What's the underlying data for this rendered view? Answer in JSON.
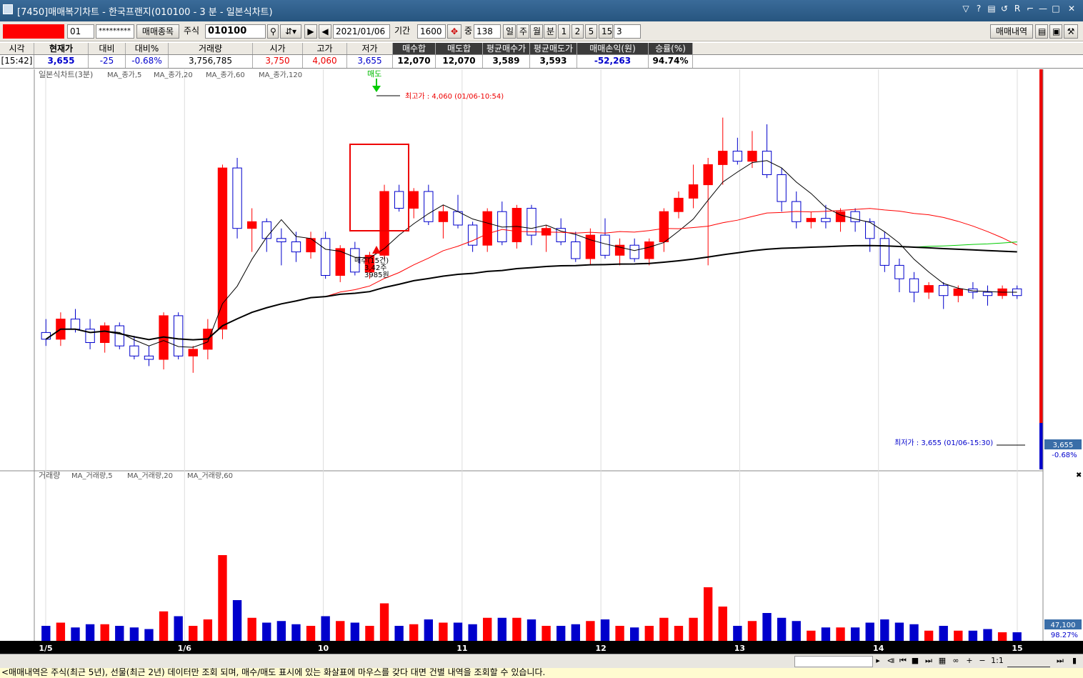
{
  "window": {
    "title": "[7450]매매복기차트 - 한국프랜지(010100 - 3 분 - 일본식차트)",
    "buttons": [
      "▽",
      "?",
      "▤",
      "↺",
      "R",
      "⌐",
      "—",
      "□",
      "✕"
    ]
  },
  "toolbar": {
    "account_no": "01",
    "password": "*********",
    "trade_item_btn": "매매종목",
    "market": "주식",
    "code": "010100",
    "date": "2021/01/06",
    "period_label": "기간",
    "period": "1600",
    "middle_label": "중",
    "count": "138",
    "periods": [
      "일",
      "주",
      "월",
      "분",
      "1",
      "2",
      "5",
      "15"
    ],
    "active_period": "분",
    "interval": "3",
    "trade_history_btn": "매매내역"
  },
  "info": {
    "headers": [
      "시각",
      "현재가",
      "대비",
      "대비%",
      "거래량",
      "시가",
      "고가",
      "저가",
      "매수합",
      "매도합",
      "평균매수가",
      "평균매도가",
      "매매손익(원)",
      "승률(%)"
    ],
    "values": [
      "[15:42]",
      "3,655",
      "-25",
      "-0.68%",
      "3,756,785",
      "3,750",
      "4,060",
      "3,655",
      "12,070",
      "12,070",
      "3,589",
      "3,593",
      "-52,263",
      "94.74%"
    ]
  },
  "price_panel": {
    "legend": "일본식차트(3분)",
    "ma_labels": [
      "MA_종가,5",
      "MA_종가,20",
      "MA_종가,60",
      "MA_종가,120"
    ],
    "high_note": "최고가 : 4,060 (01/06-10:54)",
    "low_note": "최저가 : 3,655 (01/06-15:30)",
    "sell_marker": "매도",
    "buy_note": [
      "매수(15건)",
      "3,42주",
      "3985원"
    ],
    "current_price": "3,655",
    "current_change": "-0.68%"
  },
  "volume_panel": {
    "legend": "거래량",
    "ma_labels": [
      "MA_거래량,5",
      "MA_거래량,20",
      "MA_거래량,60"
    ],
    "current_volume": "47,100",
    "volume_ratio": "98.27%"
  },
  "x_axis": {
    "labels": [
      "1/5",
      "1/6",
      "10",
      "11",
      "12",
      "13",
      "14",
      "15"
    ]
  },
  "bottom": {
    "zoom": "1:1"
  },
  "status": "<매매내역은 주식(최근 5년), 선물(최근 2년) 데이터만 조회 되며, 매수/매도 표시에 있는 화살표에 마우스를 갖다 대면 건별 내역을 조회할 수 있습니다.",
  "colors": {
    "up": "#ff0000",
    "down": "#0000cc",
    "ma5": "#000000",
    "ma20": "#ff0000",
    "ma60": "#00cc00",
    "ma120": "#000000"
  },
  "chart_data": {
    "type": "candlestick",
    "title": "",
    "ylabel": "",
    "ylim": [
      3600,
      4100
    ],
    "series": [
      {
        "name": "MA_종가,5"
      },
      {
        "name": "MA_종가,20"
      },
      {
        "name": "MA_종가,60"
      },
      {
        "name": "MA_종가,120"
      }
    ],
    "candles": [
      [
        3740,
        3760,
        3720,
        3730
      ],
      [
        3730,
        3770,
        3720,
        3760
      ],
      [
        3760,
        3775,
        3740,
        3745
      ],
      [
        3745,
        3760,
        3715,
        3725
      ],
      [
        3725,
        3755,
        3710,
        3750
      ],
      [
        3750,
        3755,
        3715,
        3720
      ],
      [
        3720,
        3735,
        3700,
        3705
      ],
      [
        3705,
        3720,
        3690,
        3700
      ],
      [
        3700,
        3770,
        3685,
        3765
      ],
      [
        3765,
        3770,
        3700,
        3705
      ],
      [
        3705,
        3720,
        3680,
        3715
      ],
      [
        3715,
        3760,
        3700,
        3745
      ],
      [
        3745,
        3990,
        3730,
        3985
      ],
      [
        3985,
        4000,
        3880,
        3895
      ],
      [
        3895,
        3925,
        3860,
        3905
      ],
      [
        3905,
        3910,
        3860,
        3880
      ],
      [
        3880,
        3895,
        3840,
        3875
      ],
      [
        3875,
        3890,
        3845,
        3860
      ],
      [
        3860,
        3890,
        3850,
        3880
      ],
      [
        3880,
        3890,
        3820,
        3825
      ],
      [
        3825,
        3870,
        3815,
        3865
      ],
      [
        3865,
        3875,
        3825,
        3830
      ],
      [
        3830,
        3860,
        3820,
        3855
      ],
      [
        3855,
        3960,
        3850,
        3950
      ],
      [
        3950,
        3960,
        3920,
        3925
      ],
      [
        3925,
        3955,
        3910,
        3950
      ],
      [
        3950,
        3960,
        3900,
        3905
      ],
      [
        3905,
        3930,
        3880,
        3920
      ],
      [
        3920,
        3945,
        3895,
        3900
      ],
      [
        3900,
        3905,
        3860,
        3870
      ],
      [
        3870,
        3925,
        3860,
        3920
      ],
      [
        3920,
        3935,
        3870,
        3875
      ],
      [
        3875,
        3930,
        3865,
        3925
      ],
      [
        3925,
        3930,
        3870,
        3885
      ],
      [
        3885,
        3900,
        3860,
        3895
      ],
      [
        3895,
        3910,
        3870,
        3875
      ],
      [
        3875,
        3890,
        3845,
        3850
      ],
      [
        3850,
        3895,
        3840,
        3885
      ],
      [
        3885,
        3910,
        3850,
        3855
      ],
      [
        3855,
        3880,
        3840,
        3870
      ],
      [
        3870,
        3880,
        3845,
        3850
      ],
      [
        3850,
        3880,
        3840,
        3875
      ],
      [
        3875,
        3925,
        3860,
        3920
      ],
      [
        3920,
        3950,
        3910,
        3940
      ],
      [
        3940,
        3990,
        3925,
        3960
      ],
      [
        3960,
        4000,
        3840,
        3990
      ],
      [
        3990,
        4060,
        3960,
        4010
      ],
      [
        4010,
        4030,
        3990,
        3995
      ],
      [
        3995,
        4040,
        3985,
        4010
      ],
      [
        4010,
        4050,
        3970,
        3975
      ],
      [
        3975,
        3985,
        3920,
        3935
      ],
      [
        3935,
        3950,
        3895,
        3905
      ],
      [
        3905,
        3920,
        3895,
        3910
      ],
      [
        3910,
        3930,
        3895,
        3905
      ],
      [
        3905,
        3925,
        3890,
        3920
      ],
      [
        3920,
        3925,
        3890,
        3905
      ],
      [
        3905,
        3910,
        3860,
        3880
      ],
      [
        3880,
        3890,
        3830,
        3840
      ],
      [
        3840,
        3850,
        3800,
        3820
      ],
      [
        3820,
        3830,
        3785,
        3800
      ],
      [
        3800,
        3815,
        3790,
        3810
      ],
      [
        3810,
        3815,
        3775,
        3795
      ],
      [
        3795,
        3810,
        3785,
        3805
      ],
      [
        3805,
        3815,
        3790,
        3800
      ],
      [
        3800,
        3810,
        3780,
        3795
      ],
      [
        3795,
        3810,
        3790,
        3805
      ],
      [
        3805,
        3810,
        3790,
        3795
      ]
    ],
    "high": 4060,
    "low": 3655
  }
}
